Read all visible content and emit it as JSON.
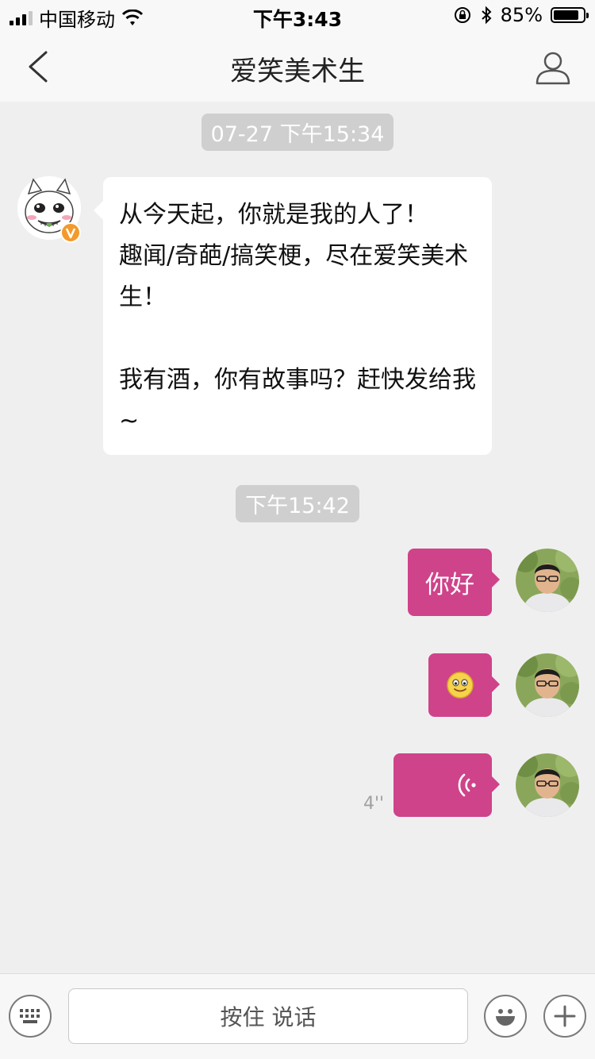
{
  "status_bar": {
    "carrier": "中国移动",
    "time": "下午3:43",
    "battery_text": "85%",
    "battery_level": 0.85
  },
  "nav": {
    "title": "爱笑美术生"
  },
  "messages": {
    "timestamp_1": "07-27 下午15:34",
    "incoming_text": "从今天起，你就是我的人了！\n趣闻/奇葩/搞笑梗，尽在爱笑美术生！\n\n我有酒，你有故事吗？赶快发给我~",
    "timestamp_2": "下午15:42",
    "outgoing_1": "你好",
    "voice_duration": "4''"
  },
  "input_bar": {
    "hold_to_talk": "按住 说话"
  },
  "colors": {
    "accent_bubble": "#cf438a",
    "background": "#f0eff0",
    "bar": "#f8f8f8",
    "verified_badge": "#f39a2b"
  }
}
